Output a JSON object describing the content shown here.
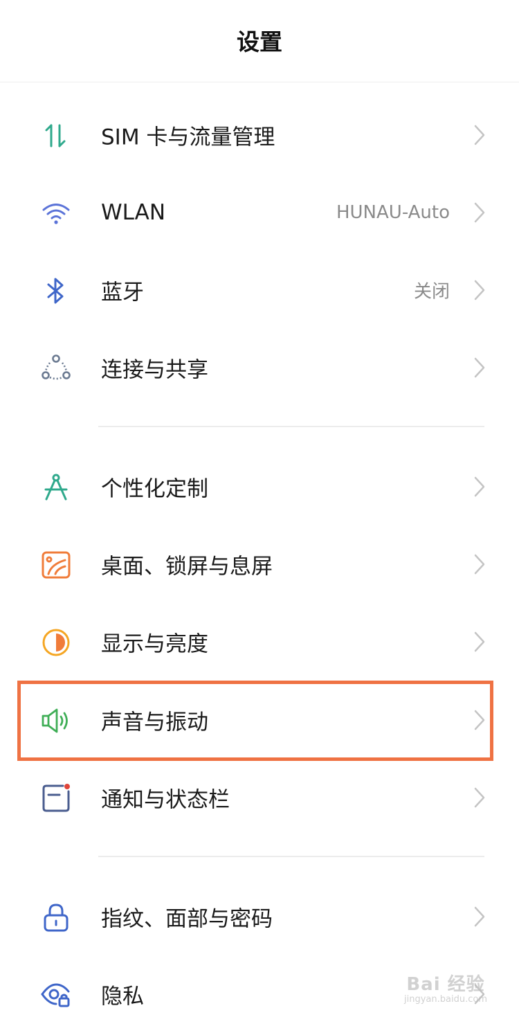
{
  "header": {
    "title": "设置"
  },
  "items": [
    {
      "label": "SIM 卡与流量管理",
      "value": "",
      "icon": "sim-data-icon",
      "color": "#2fa98c"
    },
    {
      "label": "WLAN",
      "value": "HUNAU-Auto",
      "icon": "wifi-icon",
      "color": "#5b73d8"
    },
    {
      "label": "蓝牙",
      "value": "关闭",
      "icon": "bluetooth-icon",
      "color": "#3f66c9"
    },
    {
      "label": "连接与共享",
      "value": "",
      "icon": "connection-share-icon",
      "color": "#6b7a91"
    },
    {
      "label": "个性化定制",
      "value": "",
      "icon": "compass-icon",
      "color": "#2fa98c"
    },
    {
      "label": "桌面、锁屏与息屏",
      "value": "",
      "icon": "wallpaper-icon",
      "color": "#f07c3a"
    },
    {
      "label": "显示与亮度",
      "value": "",
      "icon": "display-brightness-icon",
      "color": "#f5a623"
    },
    {
      "label": "声音与振动",
      "value": "",
      "icon": "speaker-icon",
      "color": "#3fae56"
    },
    {
      "label": "通知与状态栏",
      "value": "",
      "icon": "notification-icon",
      "color": "#4a5d8f"
    },
    {
      "label": "指纹、面部与密码",
      "value": "",
      "icon": "lock-icon",
      "color": "#3f66c9"
    },
    {
      "label": "隐私",
      "value": "",
      "icon": "privacy-eye-icon",
      "color": "#3f66c9"
    }
  ],
  "highlight_color": "#ef7243",
  "watermark": {
    "main": "Bai 经验",
    "sub": "jingyan.baidu.com"
  }
}
